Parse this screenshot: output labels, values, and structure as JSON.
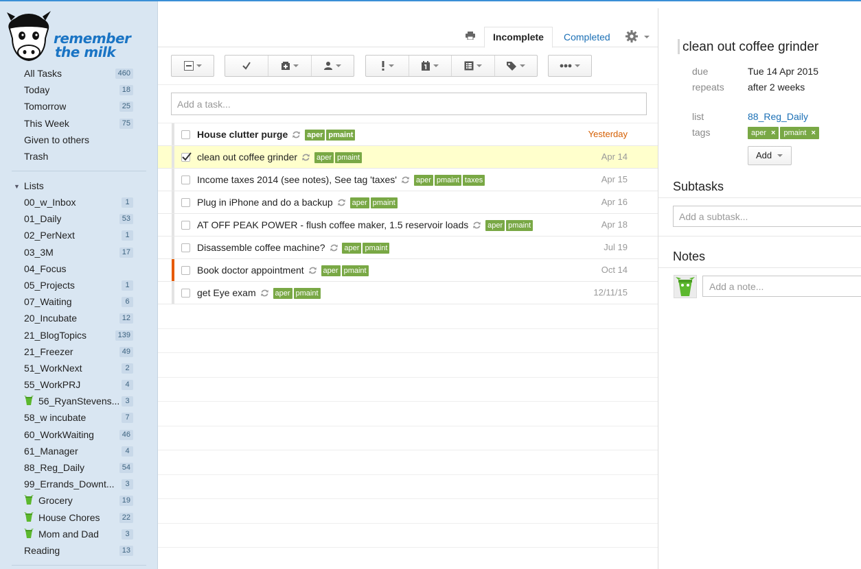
{
  "app": {
    "name": "Remember The Milk",
    "logo_line1": "remember",
    "logo_line2": "the milk"
  },
  "sidebar": {
    "smart_lists": [
      {
        "label": "All Tasks",
        "count": "460"
      },
      {
        "label": "Today",
        "count": "18"
      },
      {
        "label": "Tomorrow",
        "count": "25"
      },
      {
        "label": "This Week",
        "count": "75"
      },
      {
        "label": "Given to others",
        "count": ""
      },
      {
        "label": "Trash",
        "count": ""
      }
    ],
    "lists_header": "Lists",
    "lists": [
      {
        "label": "00_w_Inbox",
        "count": "1",
        "shared": false
      },
      {
        "label": "01_Daily",
        "count": "53",
        "shared": false
      },
      {
        "label": "02_PerNext",
        "count": "1",
        "shared": false
      },
      {
        "label": "03_3M",
        "count": "17",
        "shared": false
      },
      {
        "label": "04_Focus",
        "count": "",
        "shared": false
      },
      {
        "label": "05_Projects",
        "count": "1",
        "shared": false
      },
      {
        "label": "07_Waiting",
        "count": "6",
        "shared": false
      },
      {
        "label": "20_Incubate",
        "count": "12",
        "shared": false
      },
      {
        "label": "21_BlogTopics",
        "count": "139",
        "shared": false
      },
      {
        "label": "21_Freezer",
        "count": "49",
        "shared": false
      },
      {
        "label": "51_WorkNext",
        "count": "2",
        "shared": false
      },
      {
        "label": "55_WorkPRJ",
        "count": "4",
        "shared": false
      },
      {
        "label": "56_RyanStevens...",
        "count": "3",
        "shared": true
      },
      {
        "label": "58_w incubate",
        "count": "7",
        "shared": false
      },
      {
        "label": "60_WorkWaiting",
        "count": "46",
        "shared": false
      },
      {
        "label": "61_Manager",
        "count": "4",
        "shared": false
      },
      {
        "label": "88_Reg_Daily",
        "count": "54",
        "shared": false
      },
      {
        "label": "99_Errands_Downt...",
        "count": "3",
        "shared": false
      },
      {
        "label": "Grocery",
        "count": "19",
        "shared": true
      },
      {
        "label": "House Chores",
        "count": "22",
        "shared": true
      },
      {
        "label": "Mom and Dad",
        "count": "3",
        "shared": true
      },
      {
        "label": "Reading",
        "count": "13",
        "shared": false
      }
    ]
  },
  "main": {
    "tabs": {
      "incomplete": "Incomplete",
      "completed": "Completed"
    },
    "add_task_placeholder": "Add a task...",
    "tasks": [
      {
        "title": "House clutter purge",
        "bold": true,
        "repeat": true,
        "tags": [
          "aper",
          "pmaint"
        ],
        "due": "Yesterday",
        "overdue": true,
        "priority": "none",
        "checked": false,
        "selected": false
      },
      {
        "title": "clean out coffee grinder",
        "bold": false,
        "repeat": true,
        "tags": [
          "aper",
          "pmaint"
        ],
        "due": "Apr 14",
        "overdue": false,
        "priority": "none",
        "checked": true,
        "selected": true
      },
      {
        "title": "Income taxes 2014 (see notes), See tag 'taxes'",
        "bold": false,
        "repeat": true,
        "tags": [
          "aper",
          "pmaint",
          "taxes"
        ],
        "due": "Apr 15",
        "overdue": false,
        "priority": "none",
        "checked": false,
        "selected": false
      },
      {
        "title": "Plug in iPhone and do a backup",
        "bold": false,
        "repeat": true,
        "tags": [
          "aper",
          "pmaint"
        ],
        "due": "Apr 16",
        "overdue": false,
        "priority": "none",
        "checked": false,
        "selected": false
      },
      {
        "title": "AT OFF PEAK POWER - flush coffee maker, 1.5 reservoir loads",
        "bold": false,
        "repeat": true,
        "tags": [
          "aper",
          "pmaint"
        ],
        "due": "Apr 18",
        "overdue": false,
        "priority": "none",
        "checked": false,
        "selected": false
      },
      {
        "title": "Disassemble coffee machine?",
        "bold": false,
        "repeat": true,
        "tags": [
          "aper",
          "pmaint"
        ],
        "due": "Jul 19",
        "overdue": false,
        "priority": "none",
        "checked": false,
        "selected": false
      },
      {
        "title": "Book doctor appointment",
        "bold": false,
        "repeat": true,
        "tags": [
          "aper",
          "pmaint"
        ],
        "due": "Oct 14",
        "overdue": false,
        "priority": "high",
        "checked": false,
        "selected": false
      },
      {
        "title": "get Eye exam",
        "bold": false,
        "repeat": true,
        "tags": [
          "aper",
          "pmaint"
        ],
        "due": "12/11/15",
        "overdue": false,
        "priority": "none",
        "checked": false,
        "selected": false
      }
    ]
  },
  "detail": {
    "title": "clean out coffee grinder",
    "due_label": "due",
    "due_value": "Tue 14 Apr 2015",
    "repeats_label": "repeats",
    "repeats_value": "after 2 weeks",
    "list_label": "list",
    "list_value": "88_Reg_Daily",
    "tags_label": "tags",
    "tags": [
      "aper",
      "pmaint"
    ],
    "tag_remove_glyph": "×",
    "add_button": "Add",
    "subtasks_header": "Subtasks",
    "subtask_placeholder": "Add a subtask...",
    "notes_header": "Notes",
    "note_placeholder": "Add a note..."
  },
  "colors": {
    "accent": "#1a6fb5",
    "tag": "#79a845",
    "overdue": "#d55e00",
    "high_priority": "#e65a00",
    "selected_row": "#ffffcc",
    "sidebar": "#d9e6f2"
  }
}
